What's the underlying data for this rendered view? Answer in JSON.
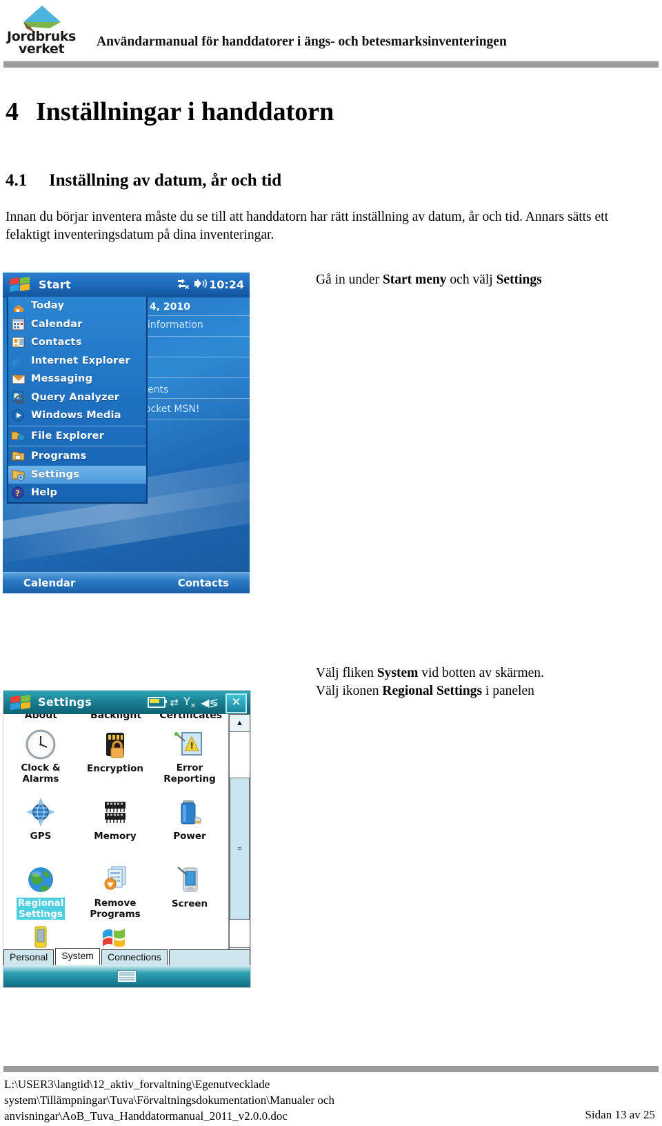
{
  "header": {
    "logo_line1": "Jordbruks",
    "logo_line2": "verket",
    "title": "Användarmanual för handdatorer i ängs- och betesmarksinventeringen"
  },
  "document": {
    "h1_number": "4",
    "h1_text": "Inställningar i handdatorn",
    "h2_number": "4.1",
    "h2_text": "Inställning av datum, år och tid",
    "paragraph": "Innan du börjar inventera måste du se till att handdatorn har rätt inställning av datum, år och tid. Annars sätts ett felaktigt inventeringsdatum på dina inventeringar.",
    "annotation_1_pre": "Gå in under ",
    "annotation_1_bold": "Start meny",
    "annotation_1_mid": " och välj ",
    "annotation_1_bold2": "Settings",
    "annotation_2_pre": "Välj fliken ",
    "annotation_2_bold": "System",
    "annotation_2_mid": " vid botten av skärmen.",
    "annotation_3_pre": "Välj ikonen ",
    "annotation_3_bold": "Regional Settings",
    "annotation_3_post": " i panelen"
  },
  "start_screen": {
    "titlebar_label": "Start",
    "clock": "10:24",
    "status_icons": [
      "connectivity-icon",
      "speaker-icon"
    ],
    "today_date": "4, 2010",
    "today_rows": [
      "information",
      "ents",
      "ocket MSN!"
    ],
    "menu_items": [
      {
        "label": "Today",
        "icon": "today-icon",
        "selected": false
      },
      {
        "label": "Calendar",
        "icon": "calendar-icon",
        "selected": false
      },
      {
        "label": "Contacts",
        "icon": "contacts-icon",
        "selected": false
      },
      {
        "label": "Internet Explorer",
        "icon": "internet-explorer-icon",
        "selected": false
      },
      {
        "label": "Messaging",
        "icon": "messaging-icon",
        "selected": false
      },
      {
        "label": "Query Analyzer",
        "icon": "query-analyzer-icon",
        "selected": false
      },
      {
        "label": "Windows Media",
        "icon": "windows-media-icon",
        "selected": false
      },
      {
        "label": "File Explorer",
        "icon": "file-explorer-icon",
        "selected": false
      },
      {
        "label": "Programs",
        "icon": "programs-folder-icon",
        "selected": false
      },
      {
        "label": "Settings",
        "icon": "settings-folder-icon",
        "selected": true
      },
      {
        "label": "Help",
        "icon": "help-icon",
        "selected": false
      }
    ],
    "softkey_left": "Calendar",
    "softkey_right": "Contacts"
  },
  "settings_screen": {
    "titlebar_label": "Settings",
    "status_icons": [
      "battery-icon",
      "connectivity-icon",
      "signal-off-icon",
      "speaker-icon"
    ],
    "close_label": "✕",
    "clipped_row": [
      "About",
      "Backlight",
      "Certificates"
    ],
    "items": [
      {
        "label": "Clock &\nAlarms",
        "icon": "clock-icon",
        "highlighted": false
      },
      {
        "label": "Encryption",
        "icon": "encryption-lock-icon",
        "highlighted": false
      },
      {
        "label": "Error\nReporting",
        "icon": "error-reporting-icon",
        "highlighted": false
      },
      {
        "label": "GPS",
        "icon": "gps-globe-icon",
        "highlighted": false
      },
      {
        "label": "Memory",
        "icon": "memory-chip-icon",
        "highlighted": false
      },
      {
        "label": "Power",
        "icon": "battery-power-icon",
        "highlighted": false
      },
      {
        "label": "Regional\nSettings",
        "icon": "regional-settings-globe-icon",
        "highlighted": true
      },
      {
        "label": "Remove\nPrograms",
        "icon": "remove-programs-icon",
        "highlighted": false
      },
      {
        "label": "Screen",
        "icon": "screen-stylus-icon",
        "highlighted": false
      }
    ],
    "tabs": [
      {
        "label": "Personal",
        "active": false
      },
      {
        "label": "System",
        "active": true
      },
      {
        "label": "Connections",
        "active": false
      }
    ],
    "scrollbar": {
      "up": "▲",
      "down": "▼",
      "thumb_grip": "≡"
    },
    "soft_input_icon": "keyboard-icon"
  },
  "footer": {
    "path_line1": "L:\\USER3\\langtid\\12_aktiv_forvaltning\\Egenutvecklade",
    "path_line2": "system\\Tillämpningar\\Tuva\\Förvaltningsdokumentation\\Manualer och",
    "path_line3": "anvisningar\\AoB_Tuva_Handdatormanual_2011_v2.0.0.doc",
    "page_label": "Sidan 13 av 25"
  },
  "colors": {
    "header_rule": "#9b9b9b",
    "start_accent": "#1f6cbd",
    "settings_accent": "#1b8395",
    "highlight": "#4ecfe0"
  }
}
